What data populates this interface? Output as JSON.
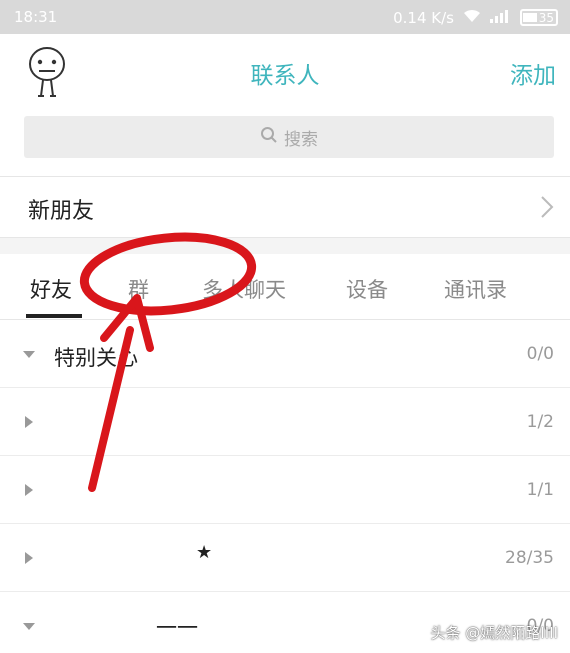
{
  "status_bar": {
    "time": "18:31",
    "network_speed": "0.14 K/s",
    "battery": "35"
  },
  "header": {
    "title": "联系人",
    "add_label": "添加"
  },
  "search": {
    "placeholder": "搜索"
  },
  "new_friends": {
    "label": "新朋友"
  },
  "tabs": [
    {
      "label": "好友",
      "active": true
    },
    {
      "label": "群",
      "active": false
    },
    {
      "label": "多人聊天",
      "active": false
    },
    {
      "label": "设备",
      "active": false
    },
    {
      "label": "通讯录",
      "active": false
    }
  ],
  "groups": [
    {
      "name": "特别关心",
      "count": "0/0",
      "expanded": true
    },
    {
      "name": "",
      "count": "1/2",
      "expanded": false
    },
    {
      "name": "",
      "count": "1/1",
      "expanded": false
    },
    {
      "name": "★",
      "count": "28/35",
      "expanded": false
    },
    {
      "name": "一一",
      "count": "0/0",
      "expanded": true
    }
  ],
  "watermark": "头条 @嫣然陌路IIII",
  "colors": {
    "accent": "#3fb5bd",
    "annotation": "#d9161b"
  },
  "icons": {
    "avatar": "cartoon-avatar-icon",
    "search": "search-icon",
    "chevron": "chevron-right-icon",
    "wifi": "wifi-icon",
    "signal": "signal-icon",
    "battery": "battery-icon"
  }
}
